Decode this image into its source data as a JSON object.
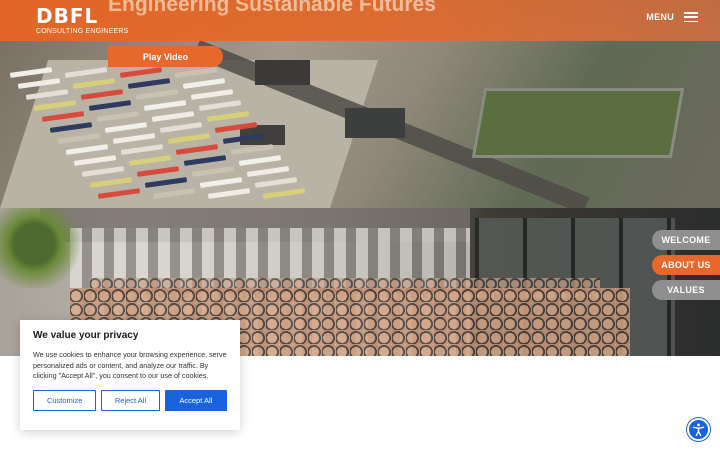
{
  "header": {
    "logo_mark": "DBFL",
    "logo_sub": "CONSULTING ENGINEERS",
    "hero_title": "Engineering Sustainable Futures",
    "menu_label": "MENU"
  },
  "hero": {
    "play_video_label": "Play Video"
  },
  "side_nav": {
    "items": [
      {
        "label": "WELCOME"
      },
      {
        "label": "ABOUT US"
      },
      {
        "label": "VALUES"
      }
    ]
  },
  "cookie_banner": {
    "title": "We value your privacy",
    "text": "We use cookies to enhance your browsing experience, serve personalized ads or content, and analyze our traffic. By clicking \"Accept All\", you consent to our use of cookies.",
    "customize_label": "Customize",
    "reject_label": "Reject All",
    "accept_label": "Accept All"
  },
  "icons": {
    "menu": "hamburger-icon",
    "accessibility": "accessibility-icon"
  },
  "colors": {
    "brand_orange": "#e8682c",
    "tab_gray": "#8f8f8f",
    "cookie_blue": "#1863dc"
  }
}
